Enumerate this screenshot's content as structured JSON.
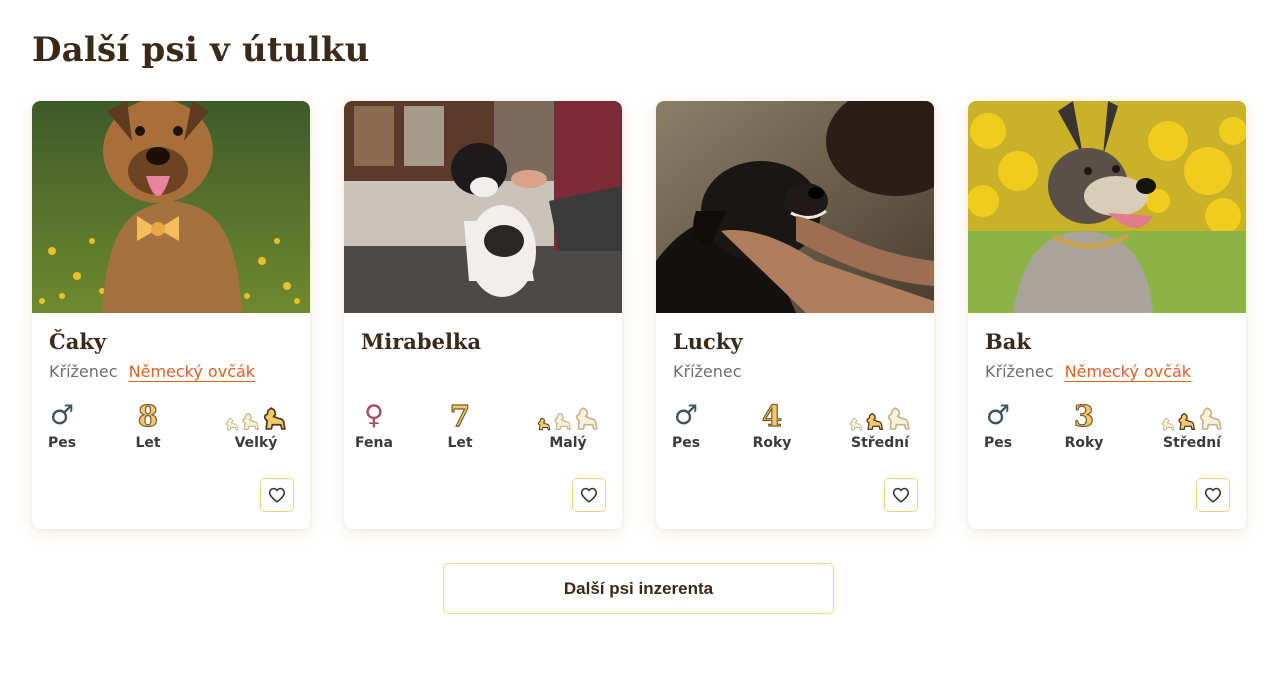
{
  "section": {
    "title": "Další psi v útulku"
  },
  "dogs": [
    {
      "name": "Čaky",
      "breed_type": "Kříženec",
      "breed_link": "Německý ovčák",
      "sex_symbol": "♂",
      "sex_label": "Pes",
      "age": "8",
      "age_unit": "Let",
      "size_label": "Velký",
      "size_level": 3,
      "sex": "male"
    },
    {
      "name": "Mirabelka",
      "breed_type": "",
      "breed_link": "",
      "sex_symbol": "♀",
      "sex_label": "Fena",
      "age": "7",
      "age_unit": "Let",
      "size_label": "Malý",
      "size_level": 1,
      "sex": "female"
    },
    {
      "name": "Lucky",
      "breed_type": "Kříženec",
      "breed_link": "",
      "sex_symbol": "♂",
      "sex_label": "Pes",
      "age": "4",
      "age_unit": "Roky",
      "size_label": "Střední",
      "size_level": 2,
      "sex": "male"
    },
    {
      "name": "Bak",
      "breed_type": "Kříženec",
      "breed_link": "Německý ovčák",
      "sex_symbol": "♂",
      "sex_label": "Pes",
      "age": "3",
      "age_unit": "Roky",
      "size_label": "Střední",
      "size_level": 2,
      "sex": "male"
    }
  ],
  "icons": {
    "favorite": "heart-outline-icon",
    "size": "dog-silhouette-icon",
    "male": "male-symbol-icon",
    "female": "female-symbol-icon"
  },
  "more_button": {
    "label": "Další psi inzerenta"
  },
  "colors": {
    "accent_link": "#d9622b",
    "button_border": "#f5d58e",
    "heading": "#3b2a1a",
    "male": "#3c5360",
    "female": "#a14d5f",
    "age_fill": "#f3c96a"
  }
}
